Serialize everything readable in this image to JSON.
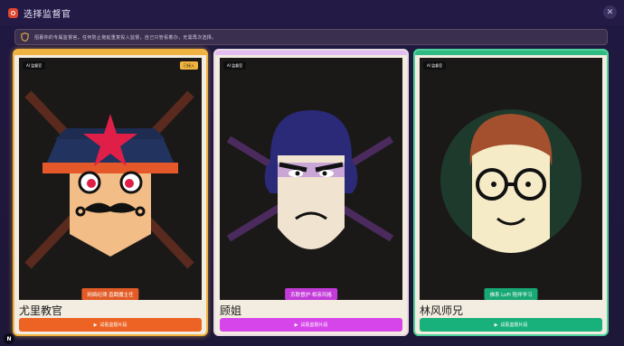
{
  "window": {
    "title": "选择监督官"
  },
  "notice": {
    "text": "招募你的专属监督官。任何防止拖延重复投入监督，自己只管看着办，无需再次选择。"
  },
  "cards": [
    {
      "ai_badge": "AI 监督官",
      "selected_badge": "已接入",
      "tag": "网络纪律·直戳魔主任",
      "name": "尤里教官",
      "button": "试看监督片段",
      "accent": "#ec6323"
    },
    {
      "ai_badge": "AI 监督官",
      "tag": "苏联督护·相亲风格",
      "name": "顾姐",
      "button": "试看监督片段",
      "accent": "#d645ea"
    },
    {
      "ai_badge": "AI 监督官",
      "tag": "佛系 LoFi 陪伴学习",
      "name": "林风师兄",
      "button": "试看监督片段",
      "accent": "#19b17b"
    }
  ],
  "corner": {
    "label": "N"
  },
  "icons": {
    "app": "app-logo-icon",
    "close": "close-icon",
    "notice": "shield-icon",
    "play": "play-icon"
  }
}
